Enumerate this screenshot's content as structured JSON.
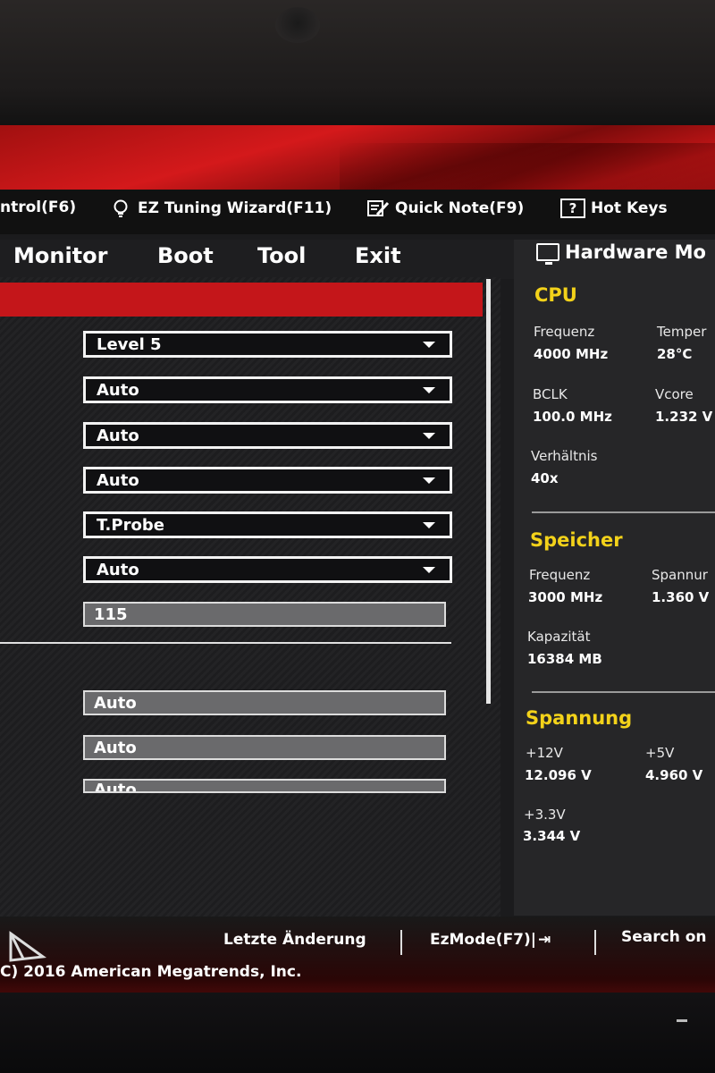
{
  "toolbar": {
    "items": [
      {
        "label": "ntrol(F6)"
      },
      {
        "label": "EZ Tuning Wizard(F11)",
        "icon": "lightbulb-icon"
      },
      {
        "label": "Quick Note(F9)",
        "icon": "note-pencil-icon"
      },
      {
        "label": "Hot Keys",
        "icon": "help-icon",
        "icon_text": "?"
      }
    ]
  },
  "menu": {
    "items": [
      "Monitor",
      "Boot",
      "Tool",
      "Exit"
    ]
  },
  "settings": {
    "dropdowns": [
      "Level 5",
      "Auto",
      "Auto",
      "Auto",
      "T.Probe",
      "Auto"
    ],
    "fields": [
      "115",
      "Auto",
      "Auto",
      "Auto"
    ]
  },
  "hardware_monitor": {
    "title": "Hardware Mo",
    "cpu": {
      "heading": "CPU",
      "freq_label": "Frequenz",
      "freq_value": "4000 MHz",
      "temp_label": "Temper",
      "temp_value": "28°C",
      "bclk_label": "BCLK",
      "bclk_value": "100.0 MHz",
      "vcore_label": "Vcore",
      "vcore_value": "1.232 V",
      "ratio_label": "Verhältnis",
      "ratio_value": "40x"
    },
    "memory": {
      "heading": "Speicher",
      "freq_label": "Frequenz",
      "freq_value": "3000 MHz",
      "volt_label": "Spannur",
      "volt_value": "1.360 V",
      "cap_label": "Kapazität",
      "cap_value": "16384 MB"
    },
    "voltage": {
      "heading": "Spannung",
      "v12_label": "+12V",
      "v12_value": "12.096 V",
      "v5_label": "+5V",
      "v5_value": "4.960 V",
      "v33_label": "+3.3V",
      "v33_value": "3.344 V"
    }
  },
  "footer": {
    "last_change": "Letzte Änderung",
    "ezmode": "EzMode(F7)|",
    "ezmode_icon": "⇥",
    "search": "Search on",
    "copyright": "C) 2016 American Megatrends, Inc."
  }
}
